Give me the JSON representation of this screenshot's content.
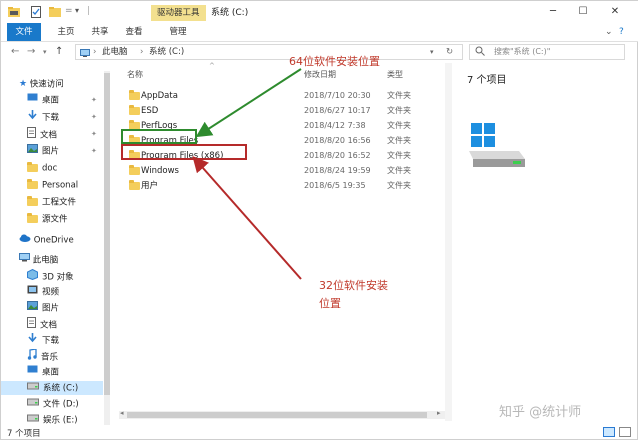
{
  "titlebar": {
    "tools_tab": "驱动器工具",
    "title": "系统 (C:)",
    "minimize": "─",
    "maximize": "☐",
    "close": "✕"
  },
  "ribbon": {
    "tabs": [
      "文件",
      "主页",
      "共享",
      "查看",
      "管理"
    ]
  },
  "address": {
    "path": [
      "此电脑",
      "系统 (C:)"
    ],
    "search_placeholder": "搜索\"系统 (C:)\""
  },
  "sidebar": {
    "quick_access": "快速访问",
    "quick_items": [
      {
        "label": "桌面",
        "icon": "desktop-icon",
        "pinned": true
      },
      {
        "label": "下载",
        "icon": "download-icon",
        "pinned": true
      },
      {
        "label": "文档",
        "icon": "document-icon",
        "pinned": true
      },
      {
        "label": "图片",
        "icon": "picture-icon",
        "pinned": true
      },
      {
        "label": "doc",
        "icon": "folder-icon",
        "pinned": false
      },
      {
        "label": "Personal",
        "icon": "folder-icon",
        "pinned": false
      },
      {
        "label": "工程文件",
        "icon": "folder-icon",
        "pinned": false
      },
      {
        "label": "源文件",
        "icon": "folder-icon",
        "pinned": false
      }
    ],
    "onedrive": "OneDrive",
    "this_pc": "此电脑",
    "pc_items": [
      {
        "label": "3D 对象",
        "icon": "cube-icon"
      },
      {
        "label": "视频",
        "icon": "video-icon"
      },
      {
        "label": "图片",
        "icon": "picture-icon"
      },
      {
        "label": "文档",
        "icon": "document-icon"
      },
      {
        "label": "下载",
        "icon": "download-icon"
      },
      {
        "label": "音乐",
        "icon": "music-icon"
      },
      {
        "label": "桌面",
        "icon": "desktop-icon"
      },
      {
        "label": "系统 (C:)",
        "icon": "drive-icon"
      },
      {
        "label": "文件 (D:)",
        "icon": "drive-icon"
      },
      {
        "label": "娱乐 (E:)",
        "icon": "drive-icon"
      }
    ]
  },
  "file_list": {
    "headers": {
      "name": "名称",
      "date": "修改日期",
      "type": "类型"
    },
    "rows": [
      {
        "name": "AppData",
        "date": "2018/7/10 20:30",
        "type": "文件夹"
      },
      {
        "name": "ESD",
        "date": "2018/6/27 10:17",
        "type": "文件夹"
      },
      {
        "name": "PerfLogs",
        "date": "2018/4/12 7:38",
        "type": "文件夹"
      },
      {
        "name": "Program Files",
        "date": "2018/8/20 16:56",
        "type": "文件夹"
      },
      {
        "name": "Program Files (x86)",
        "date": "2018/8/20 16:52",
        "type": "文件夹"
      },
      {
        "name": "Windows",
        "date": "2018/8/24 19:59",
        "type": "文件夹"
      },
      {
        "name": "用户",
        "date": "2018/6/5 19:35",
        "type": "文件夹"
      }
    ]
  },
  "preview": {
    "item_count": "7 个项目"
  },
  "status": {
    "item_count": "7 个项目"
  },
  "annotations": {
    "label_64": "64位软件安装位置",
    "label_32_line1": "32位软件安装",
    "label_32_line2": "位置",
    "green": "#2e8b2e",
    "red": "#b52a2a"
  },
  "watermark": "知乎 @统计师",
  "colors": {
    "accent": "#1979ca",
    "tools_tab": "#f3e08f",
    "selection": "#cce8ff"
  }
}
